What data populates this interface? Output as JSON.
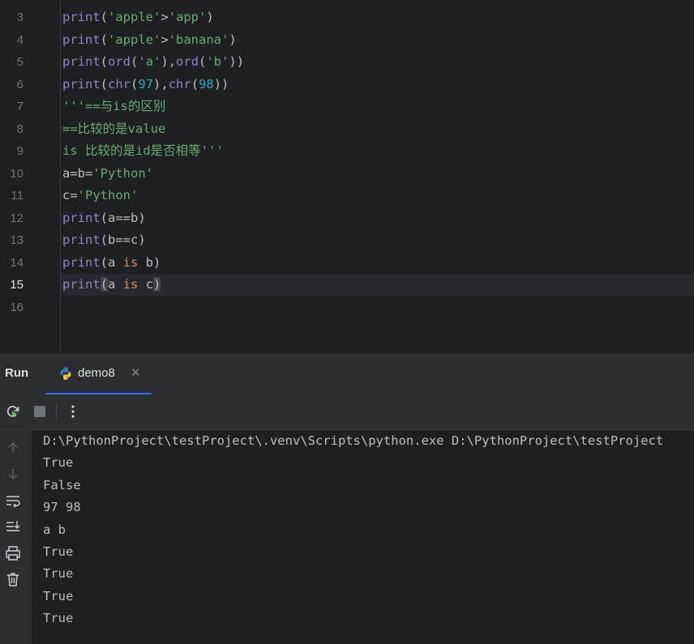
{
  "editor": {
    "line_numbers": [
      "3",
      "4",
      "5",
      "6",
      "7",
      "8",
      "9",
      "10",
      "11",
      "12",
      "13",
      "14",
      "15",
      "16"
    ],
    "current_line": "15",
    "lines": [
      [
        {
          "t": "print",
          "c": "builtin"
        },
        {
          "t": "(",
          "c": ""
        },
        {
          "t": "'apple'",
          "c": "str"
        },
        {
          "t": ">",
          "c": ""
        },
        {
          "t": "'app'",
          "c": "str"
        },
        {
          "t": ")",
          "c": ""
        }
      ],
      [
        {
          "t": "print",
          "c": "builtin"
        },
        {
          "t": "(",
          "c": ""
        },
        {
          "t": "'apple'",
          "c": "str"
        },
        {
          "t": ">",
          "c": ""
        },
        {
          "t": "'banana'",
          "c": "str"
        },
        {
          "t": ")",
          "c": ""
        }
      ],
      [
        {
          "t": "print",
          "c": "builtin"
        },
        {
          "t": "(",
          "c": ""
        },
        {
          "t": "ord",
          "c": "builtin"
        },
        {
          "t": "(",
          "c": ""
        },
        {
          "t": "'a'",
          "c": "str"
        },
        {
          "t": "),",
          "c": ""
        },
        {
          "t": "ord",
          "c": "builtin"
        },
        {
          "t": "(",
          "c": ""
        },
        {
          "t": "'b'",
          "c": "str"
        },
        {
          "t": "))",
          "c": ""
        }
      ],
      [
        {
          "t": "print",
          "c": "builtin"
        },
        {
          "t": "(",
          "c": ""
        },
        {
          "t": "chr",
          "c": "builtin"
        },
        {
          "t": "(",
          "c": ""
        },
        {
          "t": "97",
          "c": "num"
        },
        {
          "t": "),",
          "c": ""
        },
        {
          "t": "chr",
          "c": "builtin"
        },
        {
          "t": "(",
          "c": ""
        },
        {
          "t": "98",
          "c": "num"
        },
        {
          "t": "))",
          "c": ""
        }
      ],
      [
        {
          "t": "'''==与is的区别",
          "c": "str"
        }
      ],
      [
        {
          "t": "==比较的是value",
          "c": "str"
        }
      ],
      [
        {
          "t": "is 比较的是id是否相等'''",
          "c": "str"
        }
      ],
      [
        {
          "t": "a=b=",
          "c": ""
        },
        {
          "t": "'Python'",
          "c": "str"
        }
      ],
      [
        {
          "t": "c=",
          "c": ""
        },
        {
          "t": "'Python'",
          "c": "str"
        }
      ],
      [
        {
          "t": "print",
          "c": "builtin"
        },
        {
          "t": "(a==b)",
          "c": ""
        }
      ],
      [
        {
          "t": "print",
          "c": "builtin"
        },
        {
          "t": "(b==c)",
          "c": ""
        }
      ],
      [
        {
          "t": "print",
          "c": "builtin"
        },
        {
          "t": "(a ",
          "c": ""
        },
        {
          "t": "is",
          "c": "kw"
        },
        {
          "t": " b)",
          "c": ""
        }
      ],
      [
        {
          "t": "print",
          "c": "builtin"
        },
        {
          "t": "(",
          "c": "hl"
        },
        {
          "t": "a ",
          "c": ""
        },
        {
          "t": "is",
          "c": "kw"
        },
        {
          "t": " c",
          "c": ""
        },
        {
          "t": ")",
          "c": "hl"
        }
      ],
      []
    ]
  },
  "run_panel": {
    "title": "Run",
    "tab_label": "demo8",
    "close_glyph": "✕"
  },
  "console": {
    "lines": [
      "D:\\PythonProject\\testProject\\.venv\\Scripts\\python.exe D:\\PythonProject\\testProject",
      "True",
      "False",
      "97 98",
      "a b",
      "True",
      "True",
      "True",
      "True"
    ]
  }
}
